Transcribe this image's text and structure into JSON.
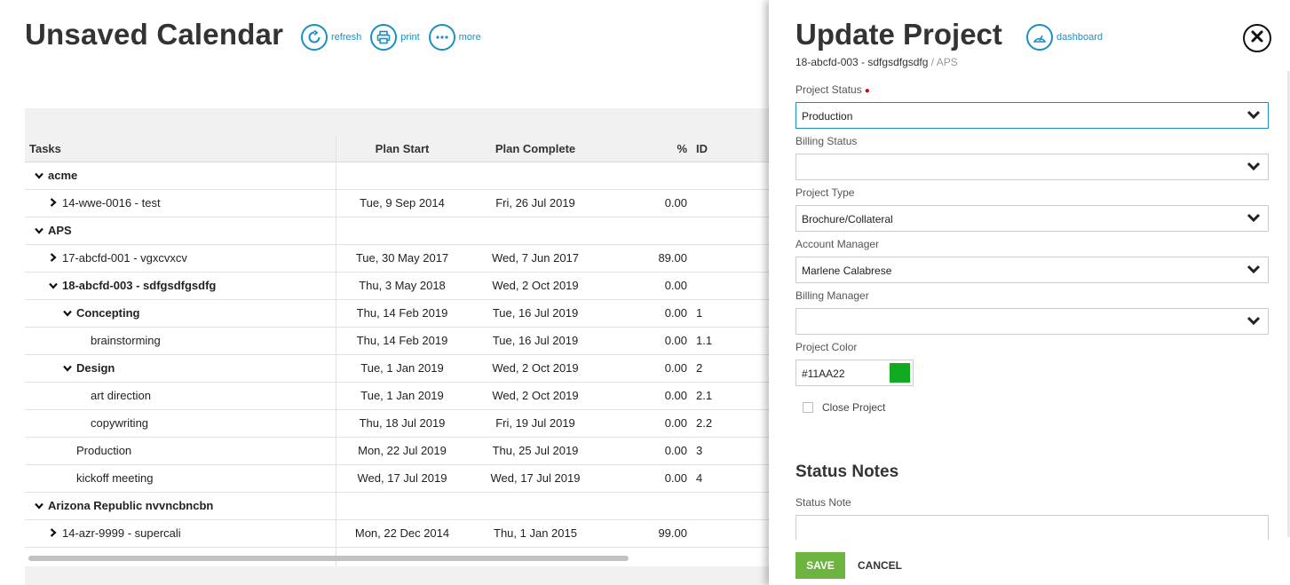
{
  "calendar": {
    "title": "Unsaved Calendar",
    "toolbar": [
      {
        "label": "refresh",
        "icon": "refresh-icon"
      },
      {
        "label": "print",
        "icon": "print-icon"
      },
      {
        "label": "more",
        "icon": "more-icon"
      }
    ],
    "columns": {
      "tasks": "Tasks",
      "plan_start": "Plan Start",
      "plan_complete": "Plan Complete",
      "pct": "%",
      "id": "ID"
    },
    "rows": [
      {
        "indent": 0,
        "chevron": "down",
        "bold": true,
        "task": "acme",
        "start": "",
        "complete": "",
        "pct": "",
        "id": ""
      },
      {
        "indent": 1,
        "chevron": "right",
        "bold": false,
        "task": "14-wwe-0016 - test",
        "start": "Tue, 9 Sep 2014",
        "complete": "Fri, 26 Jul 2019",
        "pct": "0.00",
        "id": ""
      },
      {
        "indent": 0,
        "chevron": "down",
        "bold": true,
        "task": "APS",
        "start": "",
        "complete": "",
        "pct": "",
        "id": ""
      },
      {
        "indent": 1,
        "chevron": "right",
        "bold": false,
        "task": "17-abcfd-001 - vgxcvxcv",
        "start": "Tue, 30 May 2017",
        "complete": "Wed, 7 Jun 2017",
        "pct": "89.00",
        "id": ""
      },
      {
        "indent": 1,
        "chevron": "down",
        "bold": true,
        "task": "18-abcfd-003 - sdfgsdfgsdfg",
        "start": "Thu, 3 May 2018",
        "complete": "Wed, 2 Oct 2019",
        "pct": "0.00",
        "id": ""
      },
      {
        "indent": 2,
        "chevron": "down",
        "bold": true,
        "task": "Concepting",
        "start": "Thu, 14 Feb 2019",
        "complete": "Tue, 16 Jul 2019",
        "pct": "0.00",
        "id": "1"
      },
      {
        "indent": 3,
        "chevron": "",
        "bold": false,
        "task": "brainstorming",
        "start": "Thu, 14 Feb 2019",
        "complete": "Tue, 16 Jul 2019",
        "pct": "0.00",
        "id": "1.1"
      },
      {
        "indent": 2,
        "chevron": "down",
        "bold": true,
        "task": "Design",
        "start": "Tue, 1 Jan 2019",
        "complete": "Wed, 2 Oct 2019",
        "pct": "0.00",
        "id": "2"
      },
      {
        "indent": 3,
        "chevron": "",
        "bold": false,
        "task": "art direction",
        "start": "Tue, 1 Jan 2019",
        "complete": "Wed, 2 Oct 2019",
        "pct": "0.00",
        "id": "2.1"
      },
      {
        "indent": 3,
        "chevron": "",
        "bold": false,
        "task": "copywriting",
        "start": "Thu, 18 Jul 2019",
        "complete": "Fri, 19 Jul 2019",
        "pct": "0.00",
        "id": "2.2"
      },
      {
        "indent": 2,
        "chevron": "",
        "bold": false,
        "task": "Production",
        "start": "Mon, 22 Jul 2019",
        "complete": "Thu, 25 Jul 2019",
        "pct": "0.00",
        "id": "3"
      },
      {
        "indent": 2,
        "chevron": "",
        "bold": false,
        "task": "kickoff meeting",
        "start": "Wed, 17 Jul 2019",
        "complete": "Wed, 17 Jul 2019",
        "pct": "0.00",
        "id": "4"
      },
      {
        "indent": 0,
        "chevron": "down",
        "bold": true,
        "task": "Arizona Republic nvvncbncbn",
        "start": "",
        "complete": "",
        "pct": "",
        "id": ""
      },
      {
        "indent": 1,
        "chevron": "right",
        "bold": false,
        "task": "14-azr-9999 - supercali",
        "start": "Mon, 22 Dec 2014",
        "complete": "Thu, 1 Jan 2015",
        "pct": "99.00",
        "id": ""
      }
    ]
  },
  "panel": {
    "title": "Update Project",
    "dashboard_label": "dashboard",
    "subtitle_project": "18-abcfd-003 - sdfgsdfgsdfg",
    "subtitle_client": " / APS",
    "project_status_label": "Project Status",
    "project_status_value": "Production",
    "billing_status_label": "Billing Status",
    "billing_status_value": "",
    "project_type_label": "Project Type",
    "project_type_value": "Brochure/Collateral",
    "account_manager_label": "Account Manager",
    "account_manager_value": "Marlene Calabrese",
    "billing_manager_label": "Billing Manager",
    "billing_manager_value": "",
    "project_color_label": "Project Color",
    "project_color_value": "#11AA22",
    "close_project_label": "Close Project",
    "status_notes_title": "Status Notes",
    "status_note_label": "Status Note",
    "save_label": "SAVE",
    "cancel_label": "CANCEL"
  },
  "colors": {
    "accent": "#1a8fc7",
    "save": "#6db33f",
    "required": "#d0021b",
    "swatch": "#11AA22"
  }
}
